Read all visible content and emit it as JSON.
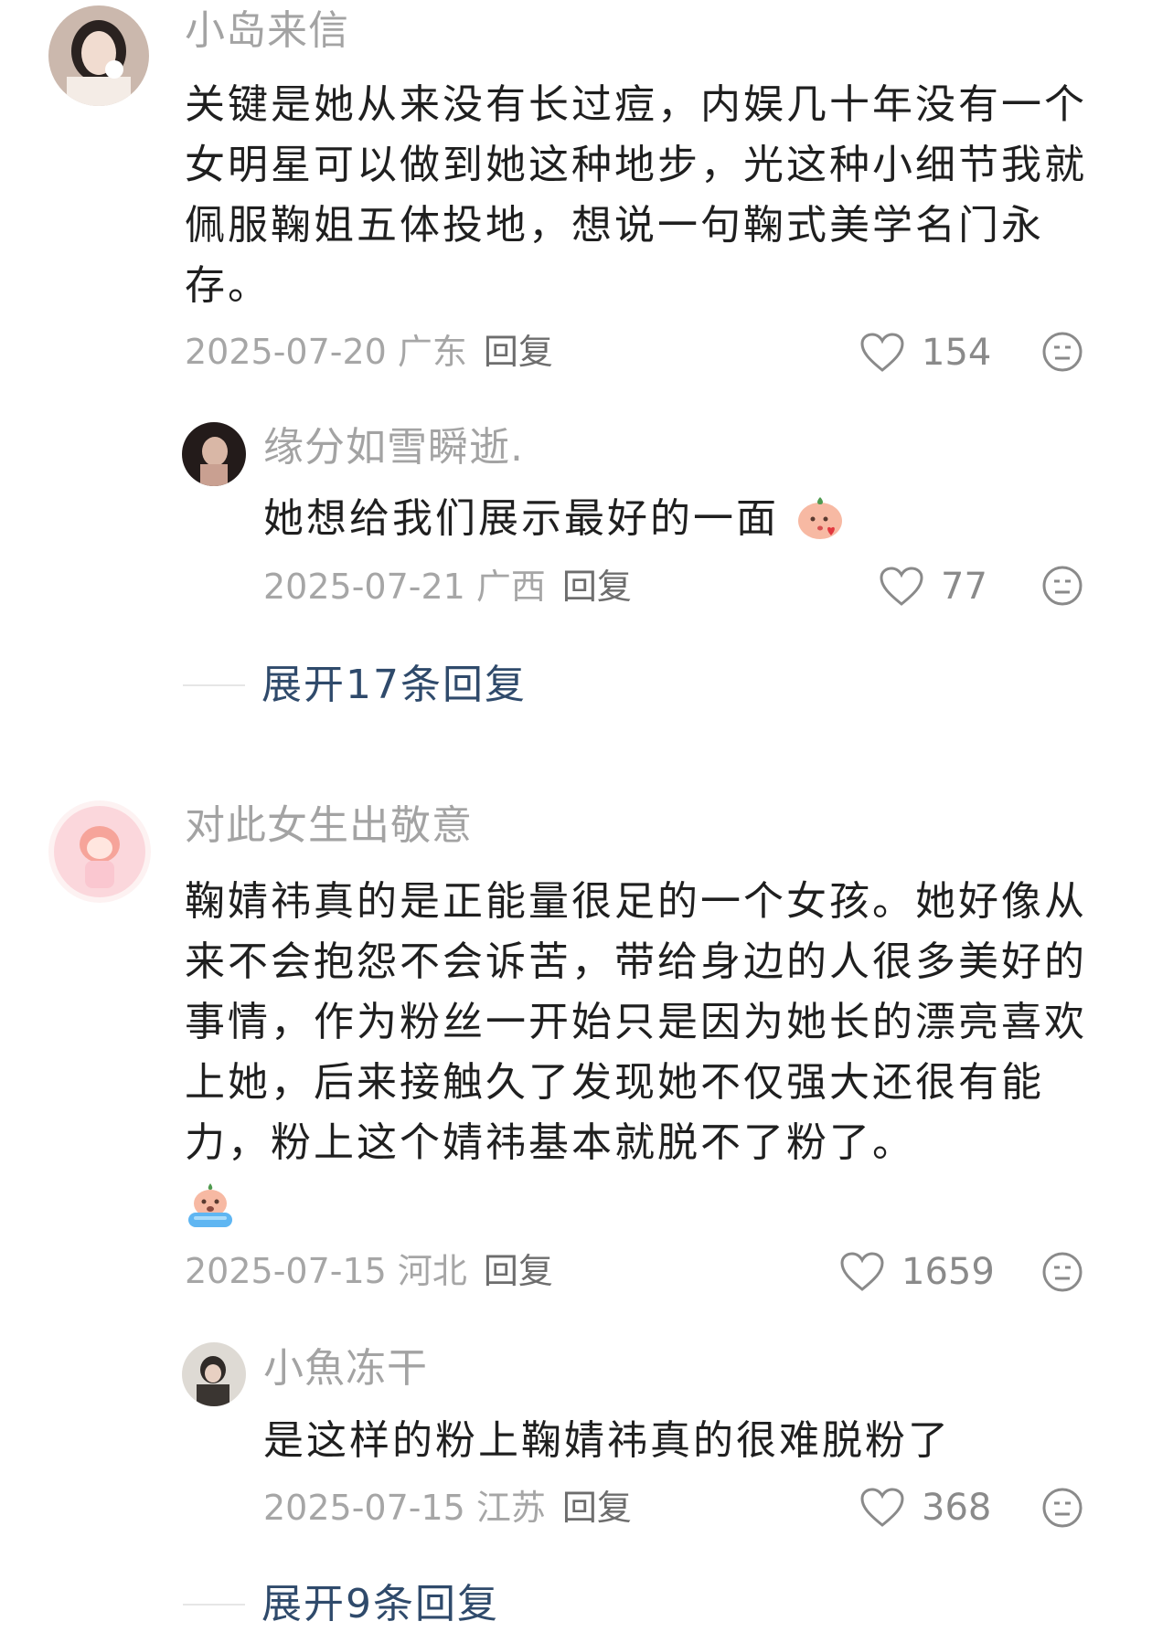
{
  "comments": [
    {
      "username": "小岛来信",
      "text": "关键是她从来没有长过痘，内娱几十年没有一个女明星可以做到她这种地步，光这种小细节我就佩服鞠姐五体投地，想说一句鞠式美学名门永存。",
      "date_region": "2025-07-20 广东",
      "reply_label": "回复",
      "likes": "154",
      "replies": [
        {
          "username": "缘分如雪瞬逝.",
          "text": "她想给我们展示最好的一面",
          "date_region": "2025-07-21 广西",
          "reply_label": "回复",
          "likes": "77"
        }
      ],
      "expand_label": "展开17条回复"
    },
    {
      "username": "对此女生出敬意",
      "text": "鞠婧祎真的是正能量很足的一个女孩。她好像从来不会抱怨不会诉苦，带给身边的人很多美好的事情，作为粉丝一开始只是因为她长的漂亮喜欢上她，后来接触久了发现她不仅强大还很有能力，粉上这个婧祎基本就脱不了粉了。",
      "date_region": "2025-07-15 河北",
      "reply_label": "回复",
      "likes": "1659",
      "replies": [
        {
          "username": "小魚冻干",
          "text": "是这样的粉上鞠婧祎真的很难脱粉了",
          "date_region": "2025-07-15 江苏",
          "reply_label": "回复",
          "likes": "368"
        }
      ],
      "expand_label": "展开9条回复"
    }
  ],
  "icons": {
    "like": "heart-outline-icon",
    "dislike": "meh-face-icon",
    "emoji1": "blushing-kiss-emoji",
    "emoji2": "crying-emoji"
  },
  "colors": {
    "username": "#a3a3a3",
    "text": "#1f1f1f",
    "meta": "#a6a6a6",
    "expand": "#2f4a6b"
  }
}
